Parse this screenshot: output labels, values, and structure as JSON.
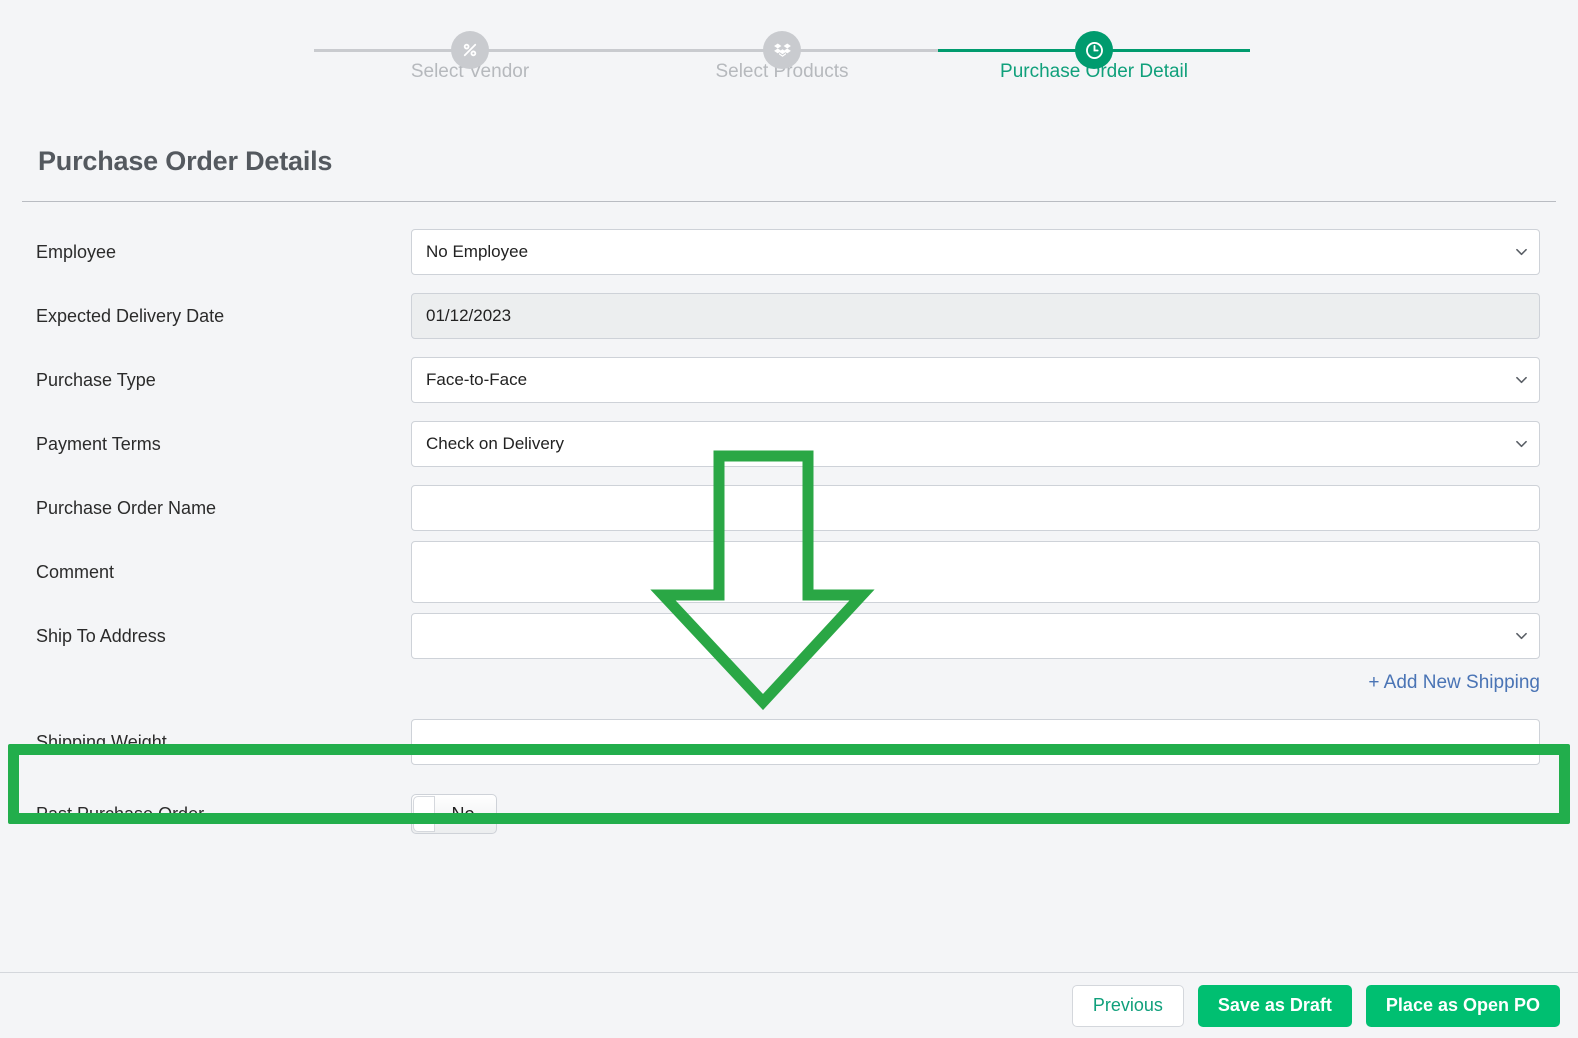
{
  "stepper": {
    "steps": [
      {
        "label": "Select Vendor",
        "icon": "percent-icon",
        "state": "pending"
      },
      {
        "label": "Select Products",
        "icon": "boxes-icon",
        "state": "pending"
      },
      {
        "label": "Purchase Order Detail",
        "icon": "clock-icon",
        "state": "active"
      }
    ]
  },
  "page": {
    "title": "Purchase Order Details"
  },
  "form": {
    "rows": [
      {
        "label": "Employee",
        "type": "select",
        "value": "No Employee"
      },
      {
        "label": "Expected Delivery Date",
        "type": "date",
        "value": "01/12/2023"
      },
      {
        "label": "Purchase Type",
        "type": "select",
        "value": "Face-to-Face"
      },
      {
        "label": "Payment Terms",
        "type": "select",
        "value": "Check on Delivery"
      },
      {
        "label": "Purchase Order Name",
        "type": "text",
        "value": ""
      },
      {
        "label": "Comment",
        "type": "textarea",
        "value": ""
      },
      {
        "label": "Ship To Address",
        "type": "select",
        "value": ""
      }
    ],
    "add_shipping_link": "+ Add New Shipping",
    "shipping_weight": {
      "label": "Shipping Weight",
      "value": ""
    },
    "past_purchase_order": {
      "label": "Past Purchase Order",
      "value": "No"
    }
  },
  "footer": {
    "previous": "Previous",
    "save_draft": "Save as Draft",
    "place_po": "Place as Open PO"
  },
  "colors": {
    "page_bg": "#f4f5f7",
    "stepper_active": "#009b6e",
    "stepper_pending": "#c9cbcf",
    "primary_button": "#00bf71",
    "annotation_green": "#22ae4c",
    "link_blue": "#4a74b5"
  }
}
